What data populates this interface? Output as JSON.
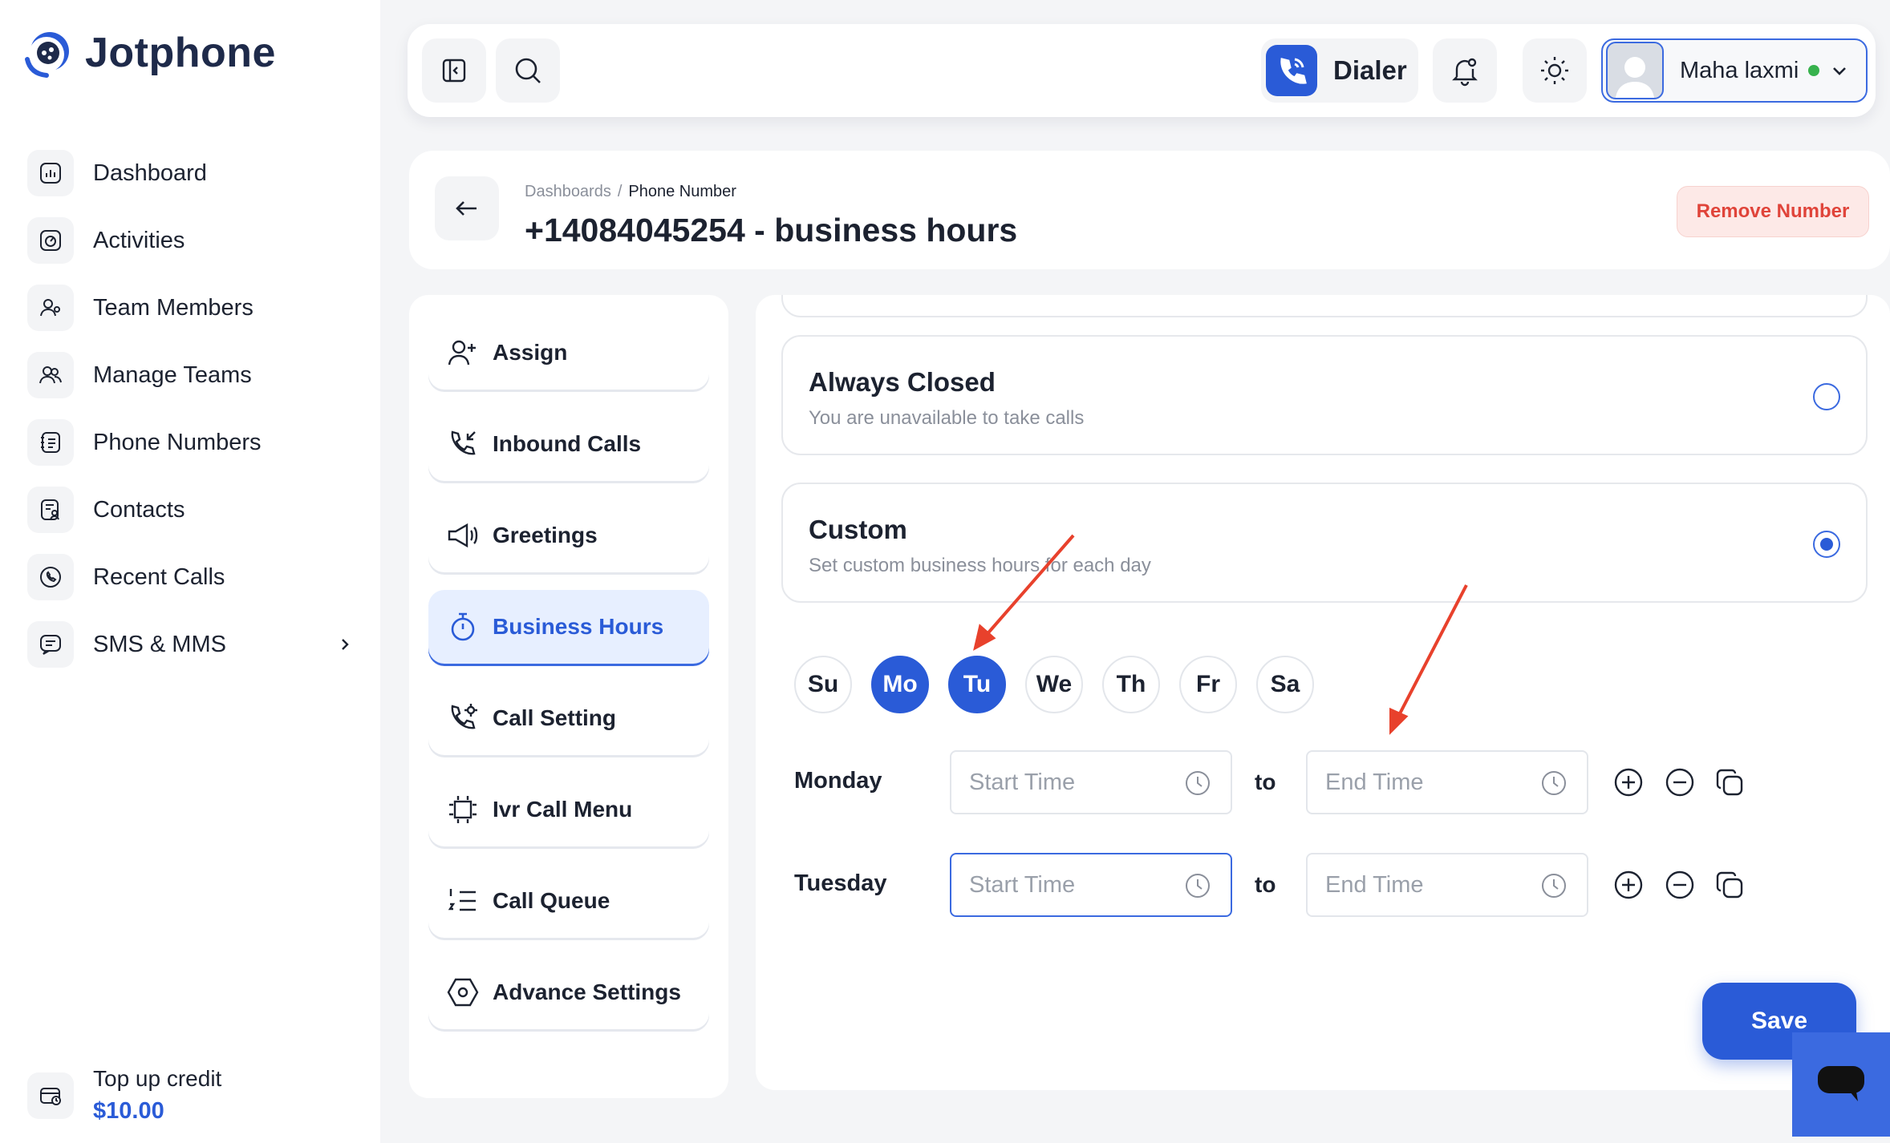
{
  "brand": {
    "name": "Jotphone",
    "accent": "#2a5bd7"
  },
  "sidebar": {
    "items": [
      {
        "label": "Dashboard",
        "icon": "chart-icon"
      },
      {
        "label": "Activities",
        "icon": "activity-icon"
      },
      {
        "label": "Team Members",
        "icon": "users-icon"
      },
      {
        "label": "Manage Teams",
        "icon": "team-icon"
      },
      {
        "label": "Phone Numbers",
        "icon": "phone-book-icon"
      },
      {
        "label": "Contacts",
        "icon": "contacts-icon"
      },
      {
        "label": "Recent Calls",
        "icon": "recent-calls-icon"
      },
      {
        "label": "SMS & MMS",
        "icon": "message-icon"
      }
    ],
    "credit": {
      "label": "Top up credit",
      "amount": "$10.00"
    }
  },
  "topbar": {
    "dialer_label": "Dialer",
    "user": {
      "name": "Maha laxmi",
      "status": "online"
    }
  },
  "header": {
    "breadcrumb": {
      "parent": "Dashboards",
      "separator": "/",
      "current": "Phone Number"
    },
    "title": "+14084045254 - business hours",
    "remove_label": "Remove Number"
  },
  "settings_menu": {
    "items": [
      {
        "label": "Assign",
        "icon": "add-user-icon"
      },
      {
        "label": "Inbound Calls",
        "icon": "inbound-call-icon"
      },
      {
        "label": "Greetings",
        "icon": "megaphone-icon"
      },
      {
        "label": "Business Hours",
        "icon": "timer-icon",
        "active": true
      },
      {
        "label": "Call Setting",
        "icon": "call-settings-icon"
      },
      {
        "label": "Ivr Call Menu",
        "icon": "ivr-icon"
      },
      {
        "label": "Call Queue",
        "icon": "list-icon"
      },
      {
        "label": "Advance Settings",
        "icon": "hexagon-settings-icon"
      }
    ]
  },
  "business_hours": {
    "options": [
      {
        "title": "Always Closed",
        "subtitle": "You are unavailable to take calls",
        "selected": false
      },
      {
        "title": "Custom",
        "subtitle": "Set custom business hours for each day",
        "selected": true
      }
    ],
    "days": [
      {
        "label": "Su",
        "selected": false
      },
      {
        "label": "Mo",
        "selected": true
      },
      {
        "label": "Tu",
        "selected": true
      },
      {
        "label": "We",
        "selected": false
      },
      {
        "label": "Th",
        "selected": false
      },
      {
        "label": "Fr",
        "selected": false
      },
      {
        "label": "Sa",
        "selected": false
      }
    ],
    "schedule": [
      {
        "day": "Monday",
        "start_placeholder": "Start Time",
        "end_placeholder": "End Time",
        "to": "to"
      },
      {
        "day": "Tuesday",
        "start_placeholder": "Start Time",
        "end_placeholder": "End Time",
        "to": "to"
      }
    ],
    "save_label": "Save"
  },
  "annotation_color": "#e8412c"
}
